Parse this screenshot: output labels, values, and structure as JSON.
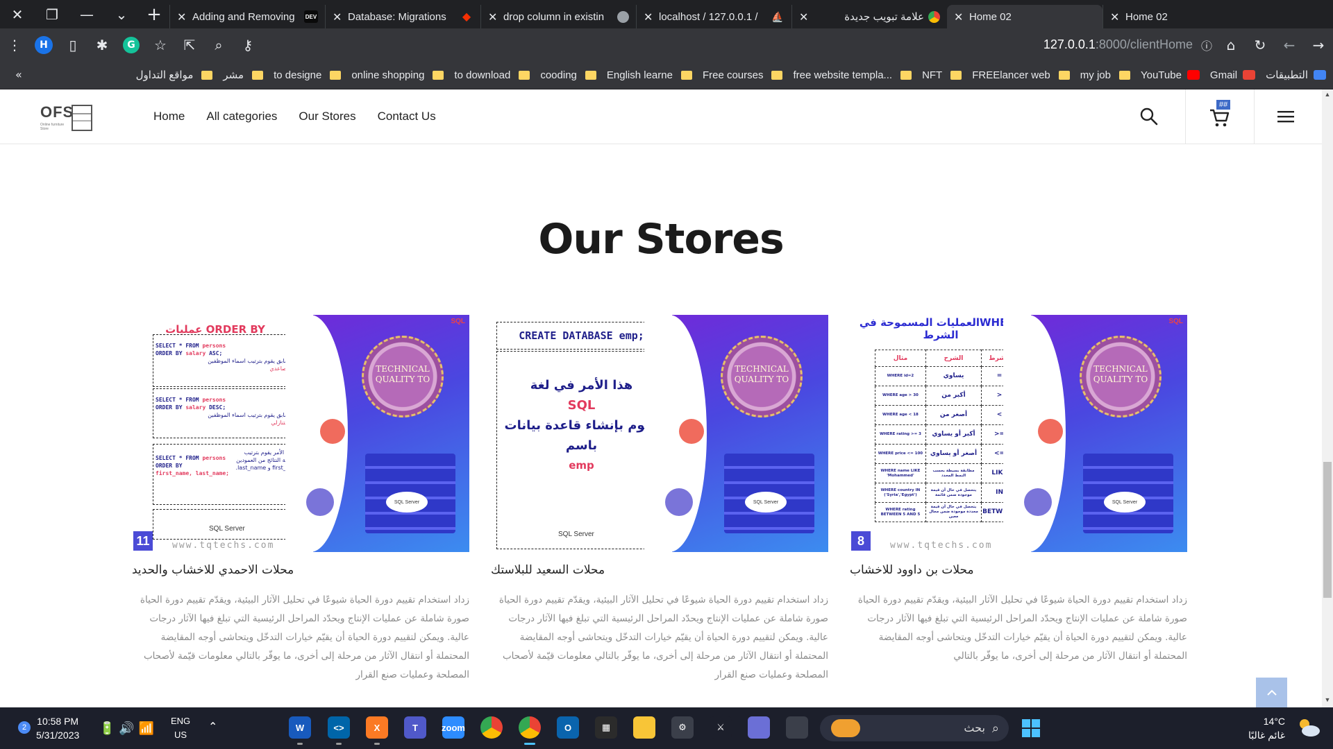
{
  "browser": {
    "tabs": [
      {
        "title": "Adding and Removing",
        "favicon": "dev-icon",
        "favicon_text": "DEV",
        "active": false,
        "rtl": false
      },
      {
        "title": "Database: Migrations",
        "favicon": "laravel-icon",
        "favicon_text": "◆",
        "active": false,
        "rtl": false
      },
      {
        "title": "drop column in existin",
        "favicon": "globe-icon",
        "favicon_text": "",
        "active": false,
        "rtl": false
      },
      {
        "title": "localhost / 127.0.0.1 /",
        "favicon": "phpmyadmin-icon",
        "favicon_text": "⛵",
        "active": false,
        "rtl": false
      },
      {
        "title": "علامة تبويب جديدة",
        "favicon": "chrome-icon",
        "favicon_text": "",
        "active": false,
        "rtl": true
      },
      {
        "title": "Home 02",
        "favicon": "none",
        "favicon_text": "",
        "active": true,
        "rtl": false
      },
      {
        "title": "Home 02",
        "favicon": "none",
        "favicon_text": "",
        "active": false,
        "rtl": false
      }
    ],
    "profile_initial": "H",
    "extension_initial": "G",
    "url_host": "127.0.0.1",
    "url_rest": ":8000/clientHome",
    "bookmarks": [
      {
        "label": "التطبيقات",
        "icon": "apps-grid-icon"
      },
      {
        "label": "Gmail",
        "icon": "gmail-icon"
      },
      {
        "label": "YouTube",
        "icon": "youtube-icon"
      },
      {
        "label": "my job",
        "icon": "folder-icon"
      },
      {
        "label": "FREElancer web",
        "icon": "folder-icon"
      },
      {
        "label": "NFT",
        "icon": "folder-icon"
      },
      {
        "label": "free website templa...",
        "icon": "folder-icon"
      },
      {
        "label": "Free courses",
        "icon": "folder-icon"
      },
      {
        "label": "English learne",
        "icon": "folder-icon"
      },
      {
        "label": "cooding",
        "icon": "folder-icon"
      },
      {
        "label": "to download",
        "icon": "folder-icon"
      },
      {
        "label": "online shopping",
        "icon": "folder-icon"
      },
      {
        "label": "to designe",
        "icon": "folder-icon"
      },
      {
        "label": "مشر",
        "icon": "folder-icon"
      },
      {
        "label": "مواقع التداول",
        "icon": "folder-icon"
      }
    ],
    "bookmarks_more": "«"
  },
  "site": {
    "logo_text": "OFS",
    "logo_sub": "Online furniture Store",
    "nav": [
      {
        "label": "Home"
      },
      {
        "label": "All categories"
      },
      {
        "label": "Our Stores"
      },
      {
        "label": "Contact Us"
      }
    ],
    "cart_badge": "##"
  },
  "main": {
    "title": "Our Stores",
    "stores": [
      {
        "name": "محلات الاحمدي للاخشاب والحديد",
        "description": "زداد استخدام تقييم دورة الحياة شيوعًا في تحليل الآثار البيئية، ويقدّم تقييم دورة الحياة صورة شاملة عن عمليات الإنتاج ويحدّد المراحل الرئيسية التي تبلغ فيها الآثار درجات عالية. ويمكن لتقييم دورة الحياة أن يقيّم خيارات التدخّل ويتحاشى أوجه المقايضة المحتملة أو انتقال الآثار من مرحلة إلى أخرى، ما يوفّر بالتالي معلومات قيّمة لأصحاب المصلحة وعمليات صنع القرار",
        "poster": {
          "heading": "ORDER BY عمليات",
          "page_number": "11",
          "watermark": "www.tqtechs.com",
          "badge": "TECHNICAL QUALITY TO"
        }
      },
      {
        "name": "محلات السعيد للبلاستك",
        "description": "زداد استخدام تقييم دورة الحياة شيوعًا في تحليل الآثار البيئية، ويقدّم تقييم دورة الحياة صورة شاملة عن عمليات الإنتاج ويحدّد المراحل الرئيسية التي تبلغ فيها الآثار درجات عالية. ويمكن لتقييم دورة الحياة أن يقيّم خيارات التدخّل ويتحاشى أوجه المقايضة المحتملة أو انتقال الآثار من مرحلة إلى أخرى، ما يوفّر بالتالي معلومات قيّمة لأصحاب المصلحة وعمليات صنع القرار",
        "poster": {
          "heading": "CREATE DATABASE emp;",
          "body_line1": "هذا الأمر في لغة",
          "body_line2": "SQL",
          "body_line3": "يقوم بإنشاء قاعدة بيانات",
          "body_line4": "باسم",
          "body_line5": "emp",
          "badge": "TECHNICAL QUALITY TO"
        }
      },
      {
        "name": "محلات بن داوود للاخشاب",
        "description": "زداد استخدام تقييم دورة الحياة شيوعًا في تحليل الآثار البيئية، ويقدّم تقييم دورة الحياة صورة شاملة عن عمليات الإنتاج ويحدّد المراحل الرئيسية التي تبلغ فيها الآثار درجات عالية. ويمكن لتقييم دورة الحياة أن يقيّم خيارات التدخّل ويتحاشى أوجه المقايضة المحتملة أو انتقال الآثار من مرحلة إلى أخرى، ما يوفّر بالتالي",
        "poster": {
          "heading": "WHEREالعمليات المسموحة في الشرط",
          "page_number": "8",
          "watermark": "www.tqtechs.com",
          "badge": "TECHNICAL QUALITY TO",
          "table_header": [
            "مثال",
            "الشرح",
            "الشرط"
          ],
          "table_rows": [
            [
              "WHERE id=2",
              "يساوي",
              "="
            ],
            [
              "WHERE age > 30",
              "أكبر من",
              ">"
            ],
            [
              "WHERE age < 18",
              "أصغر من",
              "<"
            ],
            [
              "WHERE rating >= 3",
              "أكبر أو يساوي",
              ">="
            ],
            [
              "WHERE price <= 100",
              "أصغر أو يساوي",
              "<="
            ],
            [
              "WHERE name LIKE 'Mohammed'",
              "مطابقة بسيطة بحسب النمط المحدد",
              "LIKE"
            ],
            [
              "WHERE country IN ('Syria','Egypt')",
              "يتحصل في حال أن قيمة موجودة ضمن قائمة",
              "IN"
            ],
            [
              "WHERE rating BETWEEN 5 AND 5",
              "يتحصل في حال أن قيمة محددة موجودة ضمن مجال معين",
              "BETWEEN"
            ]
          ]
        }
      }
    ]
  },
  "taskbar": {
    "notif_count": "2",
    "time": "10:58 PM",
    "date": "5/31/2023",
    "lang_line1": "ENG",
    "lang_line2": "US",
    "search_placeholder": "بحث",
    "temperature": "14°C",
    "condition": "غائم غالبًا",
    "apps": [
      {
        "name": "word-icon",
        "label": "W",
        "color": "#185abd"
      },
      {
        "name": "vscode-icon",
        "label": "<>",
        "color": "#0065a9"
      },
      {
        "name": "xampp-icon",
        "label": "X",
        "color": "#fb7a24"
      },
      {
        "name": "teams-icon",
        "label": "T",
        "color": "#5059c9"
      },
      {
        "name": "zoom-icon",
        "label": "zoom",
        "color": "#2d8cff"
      },
      {
        "name": "chrome-icon",
        "label": "",
        "color": "#34a853"
      },
      {
        "name": "chrome-profile-icon",
        "label": "",
        "color": "#4285f4"
      },
      {
        "name": "outlook-icon",
        "label": "O",
        "color": "#0a64ad"
      },
      {
        "name": "store-icon",
        "label": "▦",
        "color": "#2b2b2b"
      },
      {
        "name": "file-explorer-icon",
        "label": "",
        "color": "#f8c537"
      },
      {
        "name": "settings-icon",
        "label": "⚙",
        "color": "#3b3f4a"
      },
      {
        "name": "predator-icon",
        "label": "⚔",
        "color": "#1c1f2b"
      },
      {
        "name": "chat-icon",
        "label": "",
        "color": "#6b6fd6"
      },
      {
        "name": "copy-icon",
        "label": "",
        "color": "#3b3f4a"
      }
    ]
  }
}
